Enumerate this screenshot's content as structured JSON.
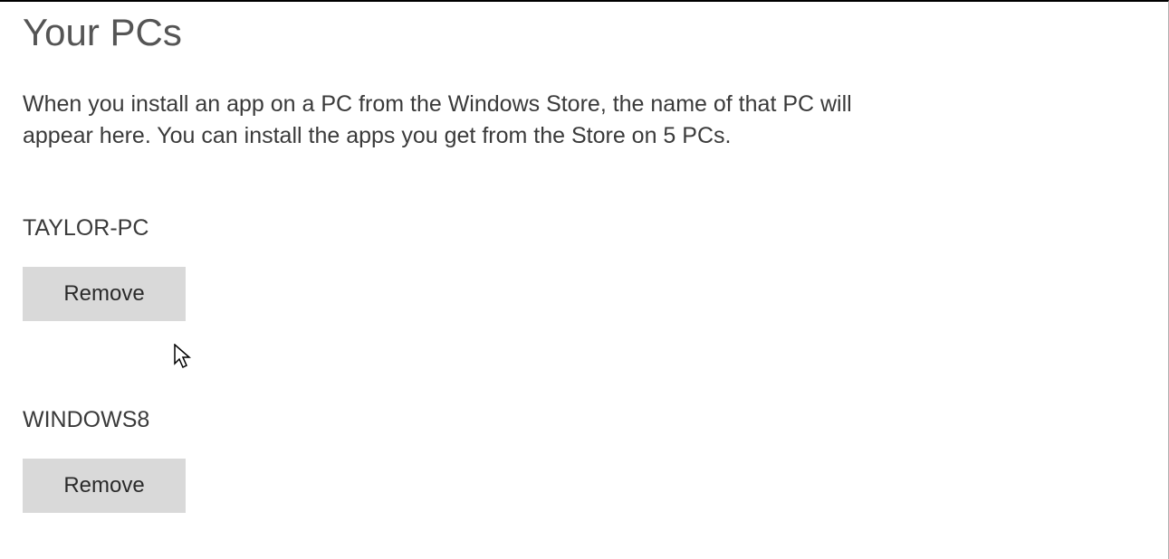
{
  "page": {
    "title": "Your PCs",
    "description": "When you install an app on a PC from the Windows Store, the name of that PC will appear here. You can install the apps you get from the Store on 5 PCs."
  },
  "pcs": [
    {
      "name": "TAYLOR-PC",
      "remove_label": "Remove"
    },
    {
      "name": "WINDOWS8",
      "remove_label": "Remove"
    }
  ]
}
